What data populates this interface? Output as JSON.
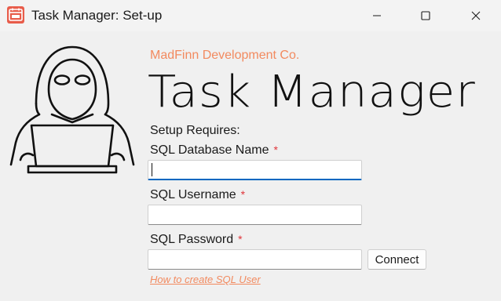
{
  "window": {
    "title": "Task Manager: Set-up",
    "icon": "calendar-task-icon",
    "controls": [
      "minimize-icon",
      "maximize-icon",
      "close-icon"
    ]
  },
  "branding": {
    "company": "MadFinn Development Co.",
    "app_name": "Task Manager",
    "illustration": "hooded-hacker-laptop-icon"
  },
  "setup": {
    "heading": "Setup Requires:",
    "required_marker": "*",
    "fields": [
      {
        "label": "SQL Database Name",
        "value": "",
        "focused": true
      },
      {
        "label": "SQL Username",
        "value": ""
      },
      {
        "label": "SQL Password",
        "value": ""
      }
    ],
    "connect_label": "Connect",
    "help_link": "How to create SQL User"
  },
  "colors": {
    "accent_orange": "#f28a5f",
    "required_red": "#e0343a",
    "focus_blue": "#0067c0",
    "app_icon": "#e85c4a"
  }
}
